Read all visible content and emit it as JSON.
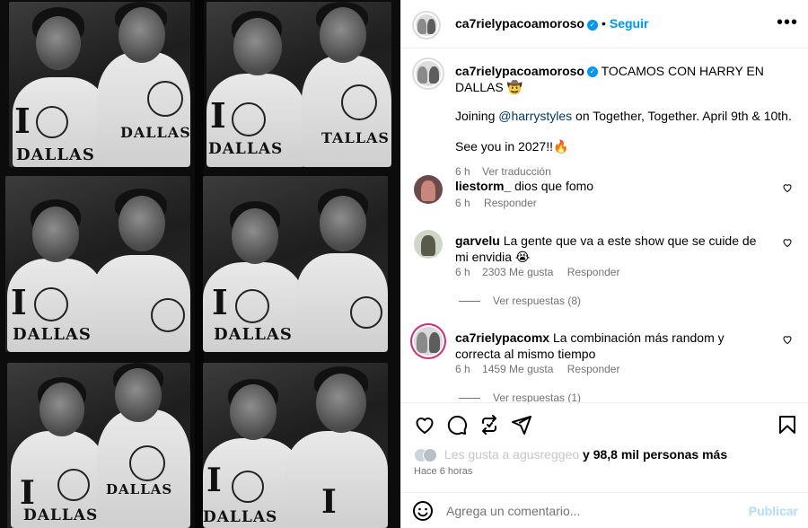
{
  "post": {
    "author": "ca7rielypacoamoroso",
    "follow_label": "Seguir",
    "separator": "•",
    "verified_mark": "✓",
    "more_label": "•••"
  },
  "photo": {
    "shirt_top_letter": "I",
    "shirt_city": "DALLAS",
    "shirt_city_partial_1": "DALLAS",
    "shirt_city_partial_2": "TALLAS",
    "shirt_city_partial_3": "DALLAS",
    "shirt_city_partial_4": "DALLAS",
    "shirt_city_partial_5": "DALLAS",
    "shirt_city_partial_6": "DALLAS",
    "shirt_city_partial_7": "DALLAS",
    "shirt_city_partial_8": "DALLAS",
    "shirt_city_partial_9": "DALLAS",
    "shirt_city_partial_10": "DALLAS",
    "shirt_city_partial_11": "DALLAS",
    "shirt_city_partial_12": "DALLAS"
  },
  "caption": {
    "author": "ca7rielypacoamoroso",
    "line1": "TOCAMOS CON HARRY EN DALLAS",
    "line1_emoji": "🤠",
    "line2_prefix": "Joining ",
    "line2_mention": "@harrystyles",
    "line2_suffix": " on Together, Together. April 9th & 10th.",
    "line3": "See you in 2027!!",
    "line3_emoji": "🔥",
    "time": "6 h",
    "translate_label": "Ver traducción"
  },
  "comments": [
    {
      "author": "liestorm_",
      "text": "dios que fomo",
      "time": "6 h",
      "likes": "",
      "reply_label": "Responder",
      "view_replies": ""
    },
    {
      "author": "garvelu",
      "text": "La gente que va a este show que se cuide de mi envidia",
      "emoji": "😭",
      "time": "6 h",
      "likes": "2303 Me gusta",
      "reply_label": "Responder",
      "view_replies": "Ver respuestas (8)"
    },
    {
      "author": "ca7rielypacomx",
      "text": "La combinación más random y correcta al mismo tiempo",
      "time": "6 h",
      "likes": "1459 Me gusta",
      "reply_label": "Responder",
      "view_replies": "Ver respuestas (1)"
    }
  ],
  "likes": {
    "faded_text": "Les gusta a agusreggeo",
    "suffix": "y 98,8 mil personas más"
  },
  "time_ago": "Hace 6 horas",
  "comment_box": {
    "placeholder": "Agrega un comentario...",
    "publish_label": "Publicar"
  },
  "icons": {
    "like": "heart-icon",
    "comment": "comment-icon",
    "share": "repost-icon",
    "send": "send-icon",
    "save": "bookmark-icon",
    "emoji": "emoji-icon",
    "more": "more-icon",
    "verified": "verified-badge-icon"
  },
  "colors": {
    "accent": "#0095f6",
    "mention": "#00376b",
    "muted": "#737373",
    "publish_disabled": "#b3dbff"
  }
}
